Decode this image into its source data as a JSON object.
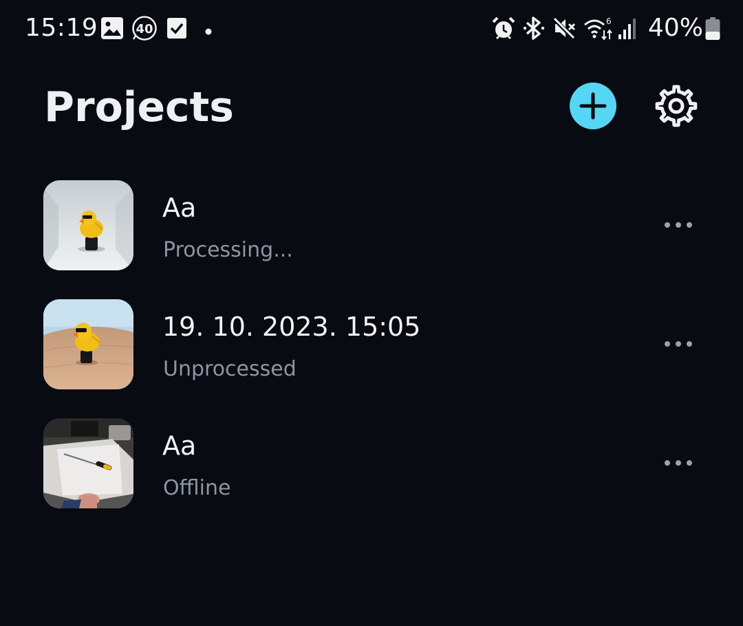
{
  "status_bar": {
    "time": "15:19",
    "notification_icons": [
      "gallery-icon",
      "badge-40-icon",
      "checkbox-icon",
      "dot-icon"
    ],
    "badge_number": "40",
    "system_icons": [
      "alarm-icon",
      "bluetooth-icon",
      "mute-icon",
      "wifi-icon",
      "signal-icon"
    ],
    "wifi_label": "6",
    "battery_percent": "40%",
    "battery_level": 0.4
  },
  "header": {
    "title": "Projects",
    "add_icon": "plus-icon",
    "settings_icon": "gear-icon",
    "accent_color": "#55d6f5"
  },
  "projects": [
    {
      "name": "Aa",
      "status": "Processing...",
      "thumbnail": "rubber duck on white background",
      "menu_icon": "more-horizontal-icon"
    },
    {
      "name": "19. 10. 2023. 15:05",
      "status": "Unprocessed",
      "thumbnail": "rubber duck on wooden table",
      "menu_icon": "more-horizontal-icon"
    },
    {
      "name": "Aa",
      "status": "Offline",
      "thumbnail": "screwdriver on paper on desk",
      "menu_icon": "more-horizontal-icon"
    }
  ]
}
